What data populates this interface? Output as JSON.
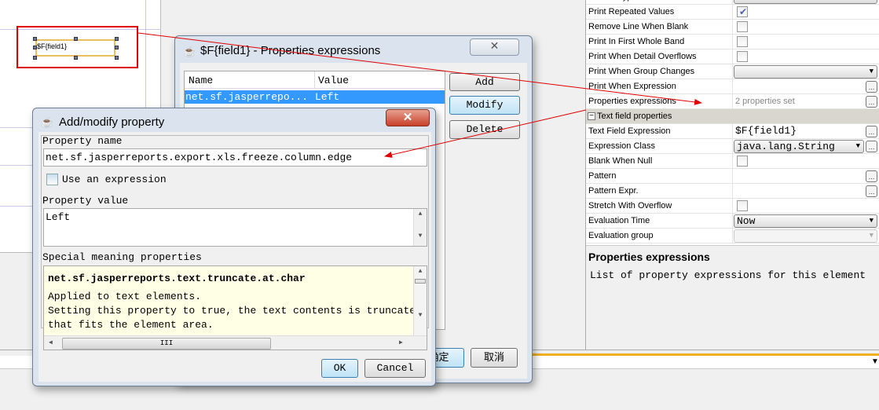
{
  "designer": {
    "field_text": "$F{field1}"
  },
  "properties": {
    "rows_top": [
      {
        "label": "Stretch Type",
        "type": "combo",
        "value": ""
      },
      {
        "label": "Print Repeated Values",
        "type": "check",
        "checked": true
      },
      {
        "label": "Remove Line When Blank",
        "type": "check",
        "checked": false
      },
      {
        "label": "Print In First Whole Band",
        "type": "check",
        "checked": false
      },
      {
        "label": "Print When Detail Overflows",
        "type": "check",
        "checked": false
      },
      {
        "label": "Print When Group Changes",
        "type": "combo",
        "value": ""
      },
      {
        "label": "Print When Expression",
        "type": "dots",
        "value": ""
      },
      {
        "label": "Properties expressions",
        "type": "dots",
        "value": "2 properties set"
      }
    ],
    "section": "Text field properties",
    "rows_bottom": [
      {
        "label": "Text Field Expression",
        "type": "dots",
        "value": "$F{field1}"
      },
      {
        "label": "Expression Class",
        "type": "combodots",
        "value": "java.lang.String"
      },
      {
        "label": "Blank When Null",
        "type": "check",
        "checked": false
      },
      {
        "label": "Pattern",
        "type": "dots",
        "value": ""
      },
      {
        "label": "Pattern Expr.",
        "type": "dots",
        "value": ""
      },
      {
        "label": "Stretch With Overflow",
        "type": "check",
        "checked": false
      },
      {
        "label": "Evaluation Time",
        "type": "combo",
        "value": "Now"
      },
      {
        "label": "Evaluation group",
        "type": "combo-disabled",
        "value": ""
      }
    ],
    "desc_title": "Properties expressions",
    "desc_text": "List of property expressions for this element"
  },
  "props_dialog": {
    "title": "$F{field1} - Properties expressions",
    "columns": [
      "Name",
      "Value"
    ],
    "rows": [
      {
        "name": "net.sf.jasperrepo...",
        "value": "Left"
      }
    ],
    "add": "Add",
    "modify": "Modify",
    "delete": "Delete",
    "ok": "确定",
    "cancel": "取消"
  },
  "add_dialog": {
    "title": "Add/modify property",
    "name_label": "Property name",
    "name_value": "net.sf.jasperreports.export.xls.freeze.column.edge",
    "use_expression": "Use an expression",
    "value_label": "Property value",
    "value": "Left",
    "special_label": "Special meaning properties",
    "special_title": "net.sf.jasperreports.text.truncate.at.char",
    "special_lines": [
      "Applied to text elements.",
      "Setting this property to true, the text contents is truncated",
      "that fits the element area."
    ],
    "ok": "OK",
    "cancel": "Cancel"
  },
  "colors": {
    "annotation": "#e00000",
    "selection": "#3399ff",
    "highlight_box": "#e8c060"
  }
}
